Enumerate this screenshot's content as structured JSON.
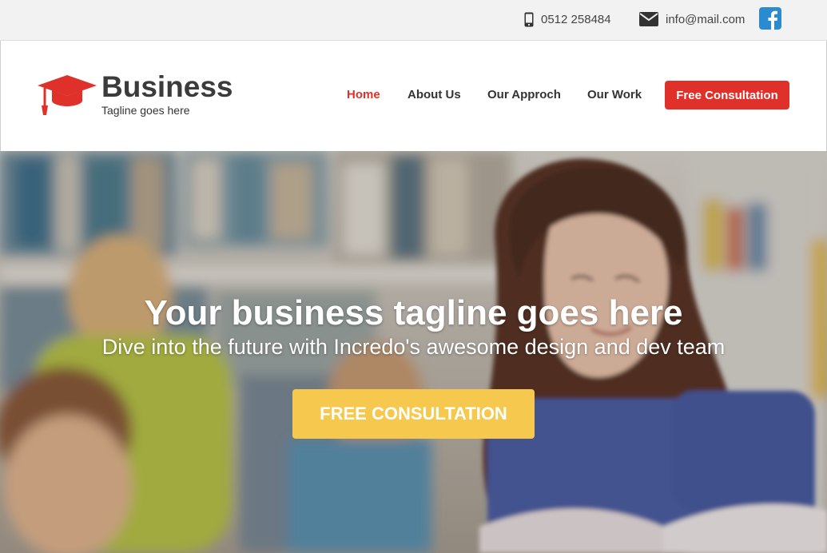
{
  "topbar": {
    "phone": "0512 258484",
    "email": "info@mail.com",
    "phone_icon": "mobile-phone-icon",
    "email_icon": "envelope-icon",
    "social_icon": "facebook-icon"
  },
  "brand": {
    "name": "Business",
    "tagline": "Tagline goes here",
    "logo_icon": "graduation-cap-icon"
  },
  "nav": {
    "items": [
      {
        "label": "Home",
        "active": true
      },
      {
        "label": "About Us",
        "active": false
      },
      {
        "label": "Our Approch",
        "active": false
      },
      {
        "label": "Our Work",
        "active": false
      }
    ],
    "cta_label": "Free Consultation"
  },
  "hero": {
    "title": "Your business tagline goes here",
    "subtitle": "Dive into the future with Incredo's awesome design and dev team",
    "cta_label": "FREE CONSULTATION"
  },
  "colors": {
    "accent_red": "#e0302a",
    "cta_yellow": "#f7c84e",
    "facebook_blue": "#2a8bd0",
    "topbar_bg": "#f2f2f2",
    "text_dark": "#333333"
  }
}
